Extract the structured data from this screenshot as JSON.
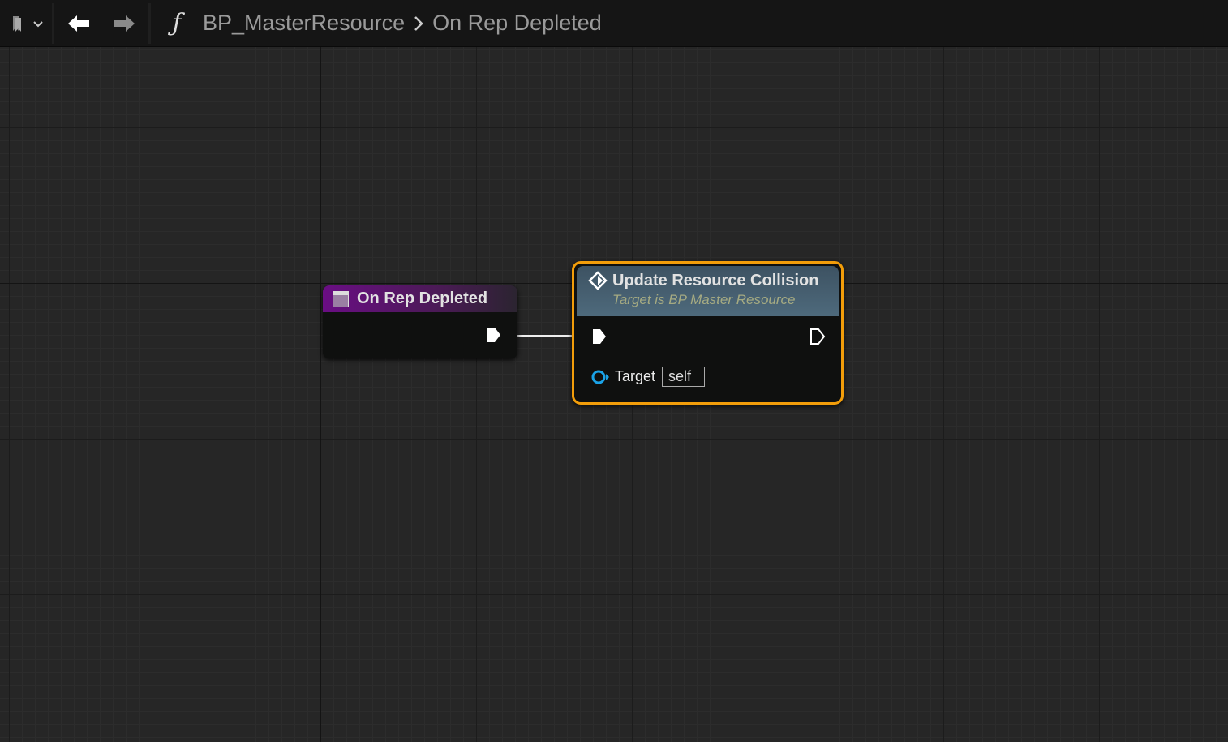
{
  "topbar": {
    "bookmark_icon": "bookmark-icon",
    "back_icon": "arrow-left-icon",
    "forward_icon": "arrow-right-icon",
    "function_icon": "function-icon",
    "breadcrumb": [
      "BP_MasterResource",
      "On Rep Depleted"
    ]
  },
  "nodes": {
    "entry": {
      "title": "On Rep Depleted",
      "color": "#6a0e84"
    },
    "call": {
      "title": "Update Resource Collision",
      "subtitle": "Target is BP Master Resource",
      "target_label": "Target",
      "target_value": "self",
      "color": "#4e6a7c",
      "selected_color": "#f29d0a"
    }
  }
}
